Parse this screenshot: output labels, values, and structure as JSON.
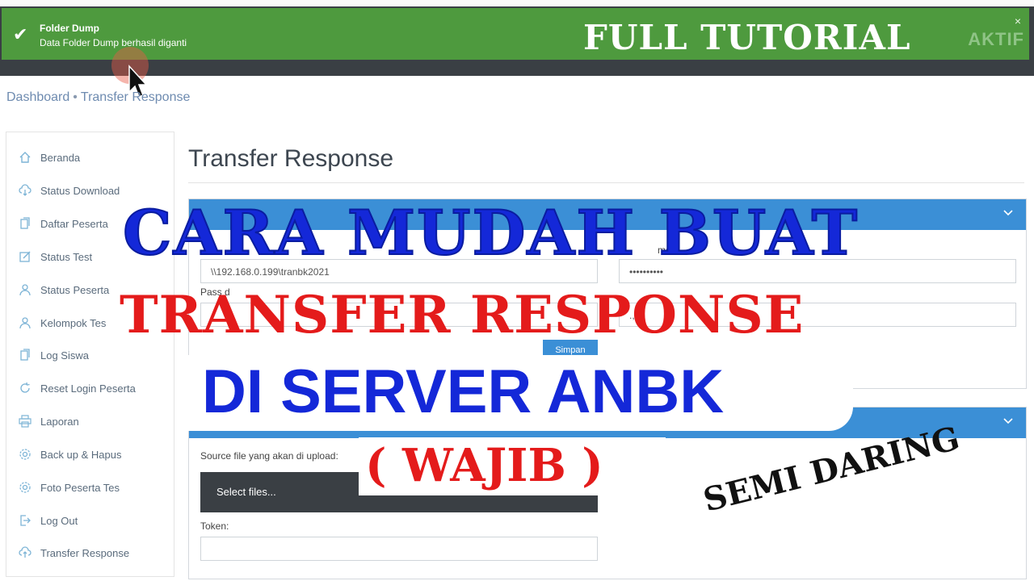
{
  "toast": {
    "title": "Folder Dump",
    "message": "Data Folder Dump berhasil diganti",
    "close": "×",
    "status_badge": "AKTIF"
  },
  "breadcrumb": {
    "root": "Dashboard",
    "separator": "•",
    "current": "Transfer Response"
  },
  "sidebar": {
    "items": [
      {
        "label": "Beranda",
        "icon": "home-icon"
      },
      {
        "label": "Status Download",
        "icon": "cloud-download-icon"
      },
      {
        "label": "Daftar Peserta",
        "icon": "documents-icon"
      },
      {
        "label": "Status Test",
        "icon": "edit-icon"
      },
      {
        "label": "Status Peserta",
        "icon": "user-icon"
      },
      {
        "label": "Kelompok Tes",
        "icon": "user-icon"
      },
      {
        "label": "Log Siswa",
        "icon": "documents-icon"
      },
      {
        "label": "Reset Login Peserta",
        "icon": "refresh-icon"
      },
      {
        "label": "Laporan",
        "icon": "printer-icon"
      },
      {
        "label": "Back up & Hapus",
        "icon": "gear-icon"
      },
      {
        "label": "Foto Peserta Tes",
        "icon": "gear-icon"
      },
      {
        "label": "Log Out",
        "icon": "logout-icon"
      },
      {
        "label": "Transfer Response",
        "icon": "cloud-upload-icon"
      }
    ]
  },
  "main": {
    "title": "Transfer Response",
    "folder_panel": {
      "path_value": "\\\\192.168.0.199\\tranbk2021",
      "username_label_fragment": "me",
      "password_label_fragment": "Pass   d",
      "password_value": "••••••••••",
      "partial_text": "., s",
      "save_label": "Simpan"
    },
    "upload_panel": {
      "source_label": "Source file yang akan di upload:",
      "select_files_label": "Select files...",
      "token_label": "Token:"
    }
  },
  "overlay": {
    "full_tutorial": "FULL TUTORIAL",
    "line1": "CARA MUDAH BUAT",
    "line2": "TRANSFER RESPONSE",
    "line3": "DI SERVER ANBK",
    "line4": "( WAJIB )",
    "corner": "SEMI DARING"
  },
  "colors": {
    "toast_green": "#4e9a3e",
    "panel_blue": "#3b8fd6",
    "overlay_blue": "#1428d8",
    "overlay_red": "#e41b1b"
  }
}
